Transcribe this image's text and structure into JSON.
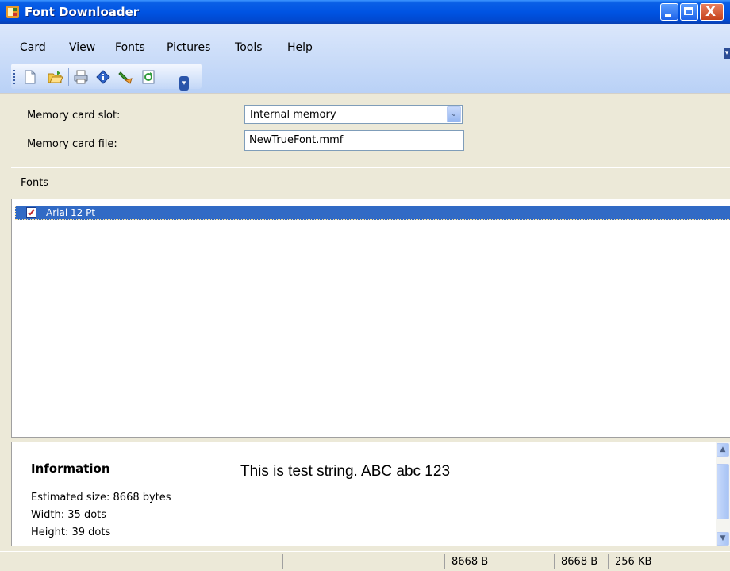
{
  "window": {
    "title": "Font Downloader",
    "close_glyph": "X"
  },
  "menu": [
    {
      "mnemonic": "C",
      "rest": "ard"
    },
    {
      "mnemonic": "V",
      "rest": "iew"
    },
    {
      "mnemonic": "F",
      "rest": "onts"
    },
    {
      "mnemonic": "P",
      "rest": "ictures"
    },
    {
      "mnemonic": "T",
      "rest": "ools"
    },
    {
      "mnemonic": "H",
      "rest": "elp"
    }
  ],
  "toolbar": {
    "icons": [
      "new-document-icon",
      "open-folder-icon",
      "print-icon",
      "info-icon",
      "download-icon",
      "refresh-icon"
    ],
    "overflow_glyph": "▾"
  },
  "memory": {
    "slot_label": "Memory card slot:",
    "slot_value": "Internal memory",
    "file_label": "Memory card file:",
    "file_value": "NewTrueFont.mmf",
    "dropdown_glyph": "⌄"
  },
  "fonts": {
    "header": "Fonts",
    "items": [
      {
        "label": "Arial 12 Pt",
        "selected": true
      }
    ]
  },
  "info": {
    "title": "Information",
    "estimated_size": "Estimated size: 8668 bytes",
    "width": "Width: 35 dots",
    "height": "Height: 39 dots",
    "test_string": "This is test string. ABC abc 123"
  },
  "scroll": {
    "up_glyph": "▲",
    "down_glyph": "▼"
  },
  "status": {
    "panel1": "",
    "panel2": "",
    "size1": "8668 B",
    "size2": "8668 B",
    "capacity": "256 KB"
  },
  "colors": {
    "titlebar": "#0054e3",
    "selection": "#316ac5",
    "face": "#ece9d8"
  }
}
